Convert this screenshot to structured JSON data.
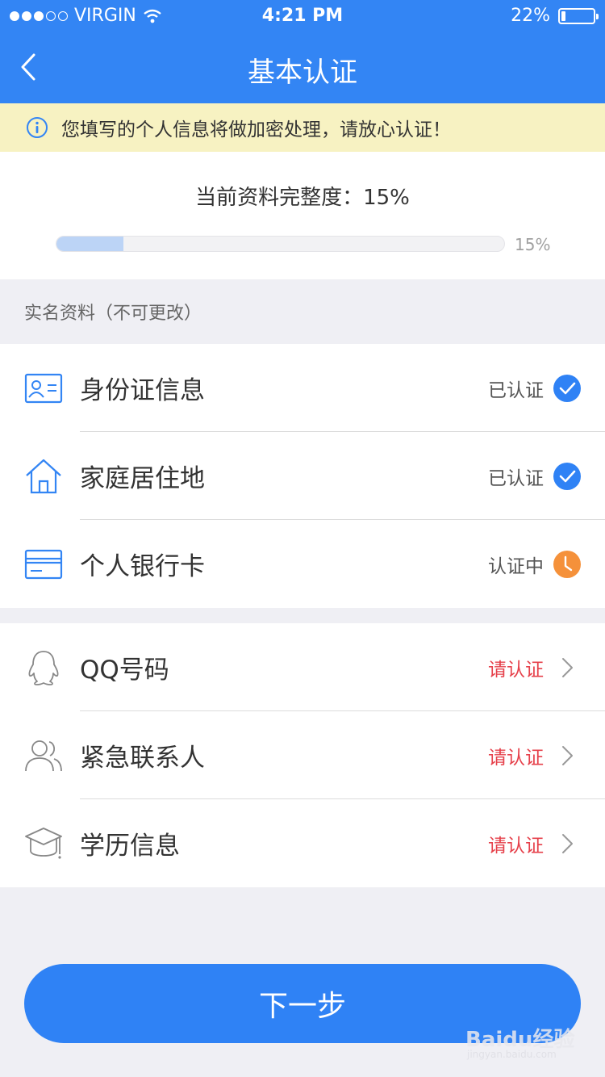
{
  "status_bar": {
    "carrier": "VIRGIN",
    "time": "4:21 PM",
    "battery": "22%",
    "battery_level": 0.22
  },
  "nav": {
    "title": "基本认证"
  },
  "notice": {
    "text": "您填写的个人信息将做加密处理，请放心认证！"
  },
  "progress": {
    "label": "当前资料完整度：15%",
    "percent_label": "15%",
    "value": 0.15
  },
  "section_real_name": {
    "title": "实名资料（不可更改）"
  },
  "real_name_items": [
    {
      "label": "身份证信息",
      "status": "已认证"
    },
    {
      "label": "家庭居住地",
      "status": "已认证"
    },
    {
      "label": "个人银行卡",
      "status": "认证中"
    }
  ],
  "other_items": [
    {
      "label": "QQ号码",
      "status": "请认证"
    },
    {
      "label": "紧急联系人",
      "status": "请认证"
    },
    {
      "label": "学历信息",
      "status": "请认证"
    }
  ],
  "next_button": {
    "label": "下一步"
  },
  "watermark": {
    "brand": "Baidu经验",
    "url": "jingyan.baidu.com"
  },
  "colors": {
    "primary": "#3385f4",
    "verified": "#2f82f5",
    "pending": "#f5913a",
    "alert_text": "#e6414b",
    "notice_bg": "#f7f2c2"
  }
}
